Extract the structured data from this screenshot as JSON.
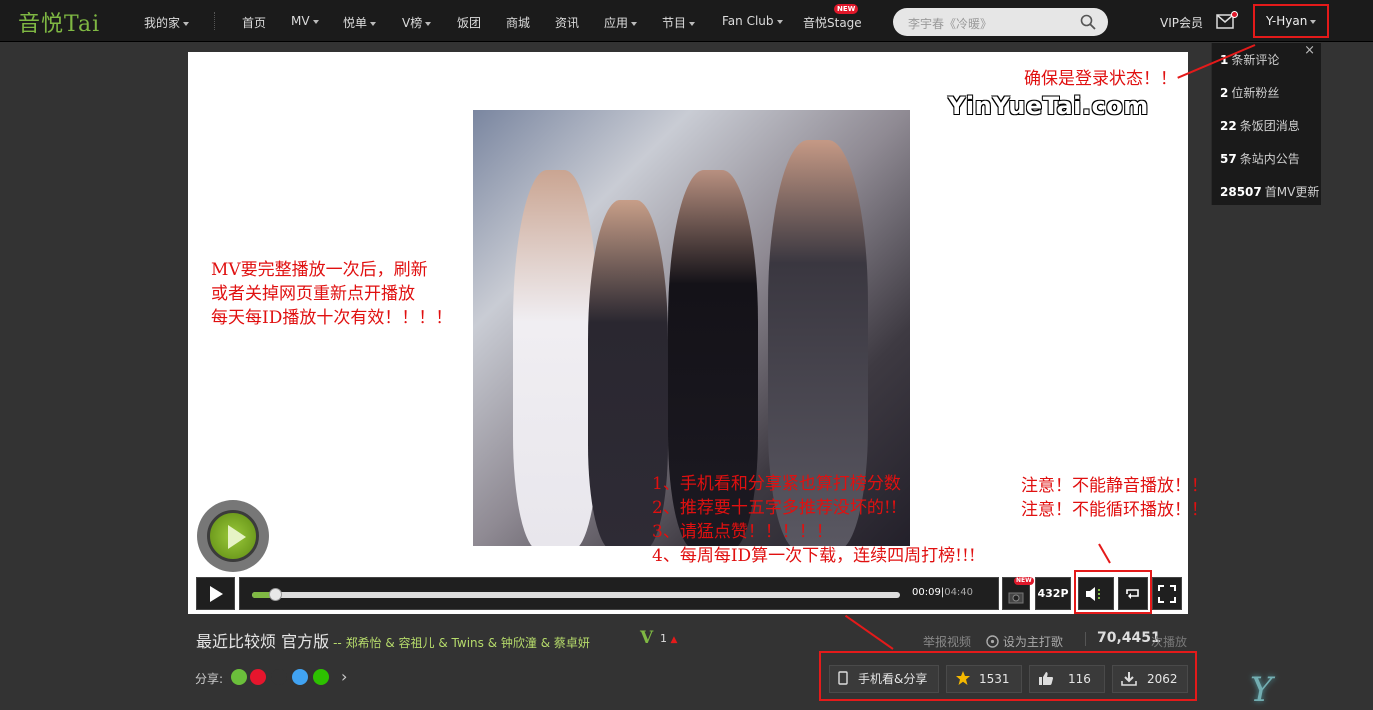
{
  "header": {
    "logo": "音悦Tai",
    "my_home": "我的家",
    "nav": [
      {
        "label": "首页",
        "caret": false
      },
      {
        "label": "MV",
        "caret": true
      },
      {
        "label": "悦单",
        "caret": true
      },
      {
        "label": "V榜",
        "caret": true
      },
      {
        "label": "饭团",
        "caret": false
      },
      {
        "label": "商城",
        "caret": false
      },
      {
        "label": "资讯",
        "caret": false
      },
      {
        "label": "应用",
        "caret": true
      },
      {
        "label": "节目",
        "caret": true
      },
      {
        "label": "Fan Club",
        "caret": true
      },
      {
        "label": "音悦Stage",
        "caret": false
      }
    ],
    "new_badge": "NEW",
    "search_placeholder": "李宇春《冷暖》",
    "vip_label": "VIP会员",
    "username": "Y-Hyan"
  },
  "notifications": {
    "close": "×",
    "items": [
      {
        "count": "1",
        "text": "条新评论"
      },
      {
        "count": "2",
        "text": "位新粉丝"
      },
      {
        "count": "22",
        "text": "条饭团消息"
      },
      {
        "count": "57",
        "text": "条站内公告"
      },
      {
        "count": "28507",
        "text": "首MV更新"
      }
    ]
  },
  "player": {
    "watermark": "YinYueTai.com",
    "time_current": "00:09",
    "time_total": "04:40",
    "progress_fraction": 0.034,
    "screenshot_new": "NEW",
    "quality": "432P"
  },
  "annotations": {
    "login": "确保是登录状态！！",
    "play_lines": [
      "MV要完整播放一次后，刷新",
      "或者关掉网页重新点开播放",
      "每天每ID播放十次有效！！！！"
    ],
    "tips_lines": [
      "1、手机看和分享紧也算打榜分数",
      "2、推荐要十五字多推荐没坏的!!",
      "3、请猛点赞！！！！！",
      "4、每周每ID算一次下载，连续四周打榜!!!"
    ],
    "warn_lines": [
      "注意！不能静音播放！！",
      "注意！不能循环播放！！"
    ]
  },
  "info": {
    "title": "最近比较烦 官方版",
    "artist": "-- 郑希怡 & 容祖儿 & Twins & 钟欣潼 & 蔡卓妍",
    "v_badge": "V",
    "rank": "1",
    "report": "举报视频",
    "set_song": "设为主打歌",
    "plays": "70,4451",
    "plays_label": "次播放"
  },
  "share": {
    "label": "分享:",
    "icon_colors": [
      "#6bbf3b",
      "#e6162d",
      "#333333",
      "#41a3f2",
      "#2dc100"
    ],
    "more": "›"
  },
  "actions": {
    "mobile": "手机看&分享",
    "favorites": "1531",
    "likes": "116",
    "downloads": "2062"
  },
  "signature": "Y"
}
